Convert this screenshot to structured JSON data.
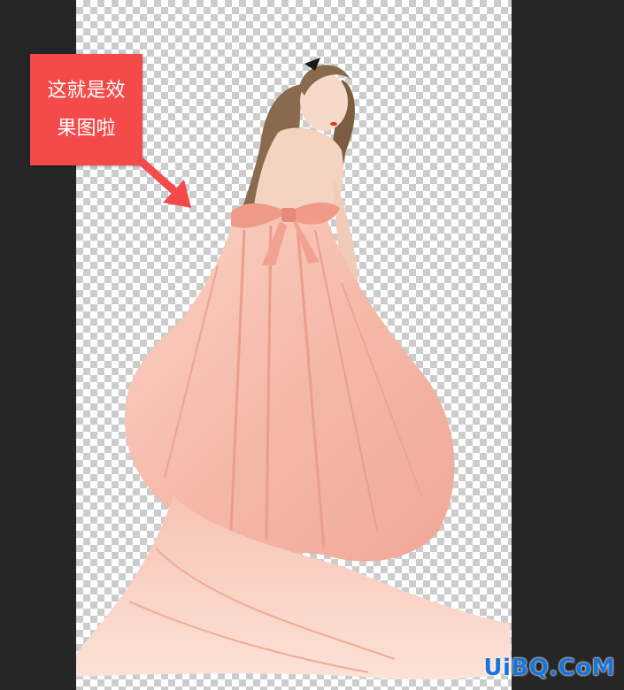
{
  "callout": {
    "line1": "这就是效",
    "line2": "果图啦"
  },
  "watermark": {
    "text": "UiBQ.CoM"
  },
  "colors": {
    "workspace": "#262626",
    "callout": "#f44a4a",
    "dress": "#f5b9a8",
    "hair": "#8a6a4e",
    "watermark": "#1a73d9"
  },
  "icons": {
    "arrow": "arrow-down-right-icon"
  }
}
